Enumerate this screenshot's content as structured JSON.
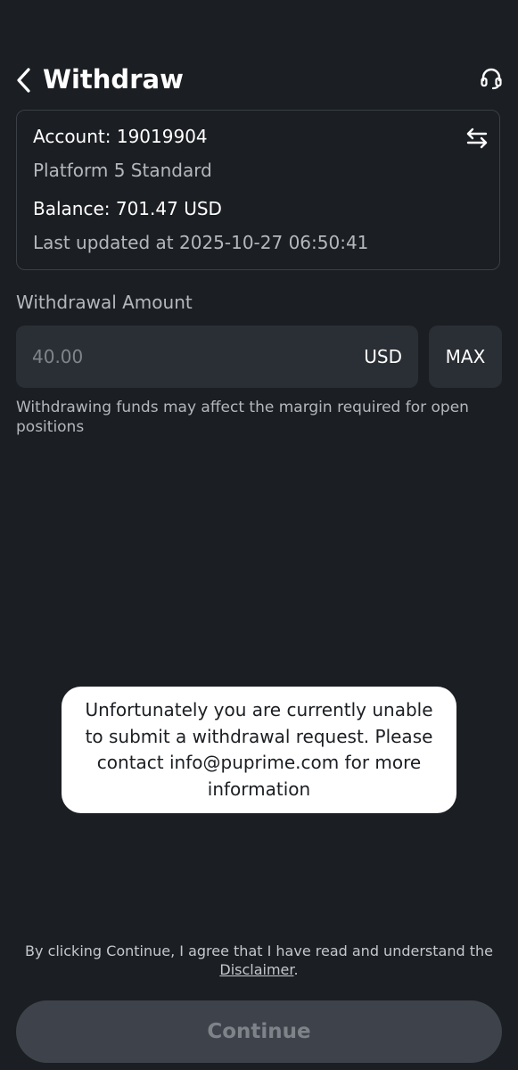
{
  "header": {
    "title": "Withdraw",
    "back_icon": "chevron-left-icon",
    "support_icon": "headset-icon"
  },
  "account": {
    "account_line": "Account: 19019904",
    "platform": "Platform 5 Standard",
    "balance_line": "Balance: 701.47 USD",
    "updated_line": "Last updated at 2025-10-27 06:50:41",
    "switch_icon": "swap-arrows-icon"
  },
  "withdrawal": {
    "label": "Withdrawal Amount",
    "placeholder": "40.00",
    "currency": "USD",
    "max_label": "MAX",
    "margin_note": "Withdrawing funds may affect the margin required for open positions"
  },
  "toast": {
    "message": "Unfortunately you are currently unable to submit a withdrawal request. Please contact info@puprime.com for more information"
  },
  "footer": {
    "agreement_text": "By clicking Continue, I agree that I have read and understand the",
    "disclaimer_link": "Disclaimer",
    "period": ".",
    "continue_label": "Continue"
  },
  "colors": {
    "background": "#1b1e22",
    "field_background": "#2a2e35",
    "card_border": "#3b4047",
    "secondary_text": "#b4b8bd",
    "button_disabled": "#3e434b",
    "button_disabled_text": "#7e838a",
    "toast_background": "#ffffff"
  }
}
